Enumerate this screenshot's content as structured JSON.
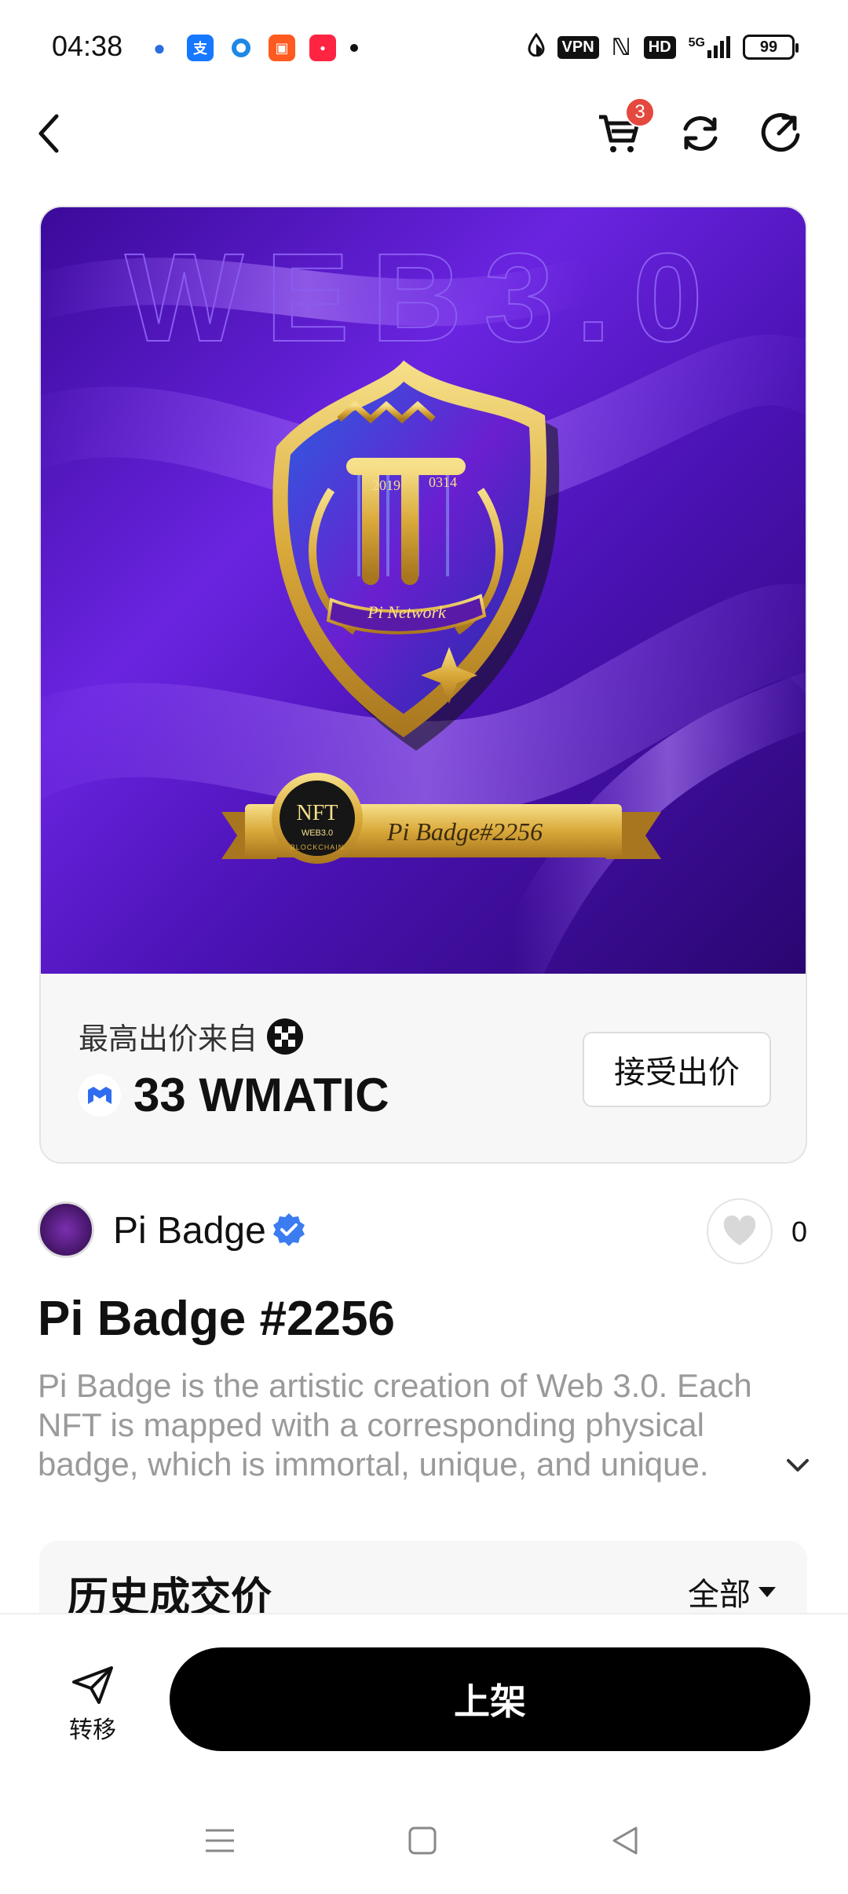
{
  "status_bar": {
    "time": "04:38",
    "icons": [
      "baidu-icon",
      "alipay-icon",
      "browser-icon",
      "kuaishou-icon",
      "xiaohongshu-icon",
      "dot-icon"
    ],
    "right": {
      "vpn": "VPN",
      "hd": "HD",
      "network": "5G",
      "battery": "99"
    }
  },
  "nav": {
    "cart_count": "3"
  },
  "nft_image": {
    "watermark": "WEB3.0",
    "shield_year": "2019",
    "shield_date": "0314",
    "shield_ribbon": "Pi Network",
    "seal_text": "NFT",
    "seal_sub": "WEB3.0",
    "seal_ring": "BLOCKCHAIN",
    "banner_text": "Pi Badge#2256",
    "colors": {
      "purple": "#5b18c9",
      "gold": "#d9a93a",
      "shield_blue": "#1c2fa8"
    }
  },
  "bid": {
    "label": "最高出价来自",
    "amount": "33 WMATIC",
    "accept_label": "接受出价"
  },
  "collection": {
    "name": "Pi Badge",
    "likes": "0"
  },
  "nft": {
    "title": "Pi Badge #2256",
    "description": "Pi Badge is the artistic creation of Web 3.0. Each NFT is mapped with a corresponding physical badge, which is immortal, unique, and unique."
  },
  "history": {
    "title": "历史成交价",
    "filter": "全部"
  },
  "bottom": {
    "transfer_label": "转移",
    "list_label": "上架"
  }
}
